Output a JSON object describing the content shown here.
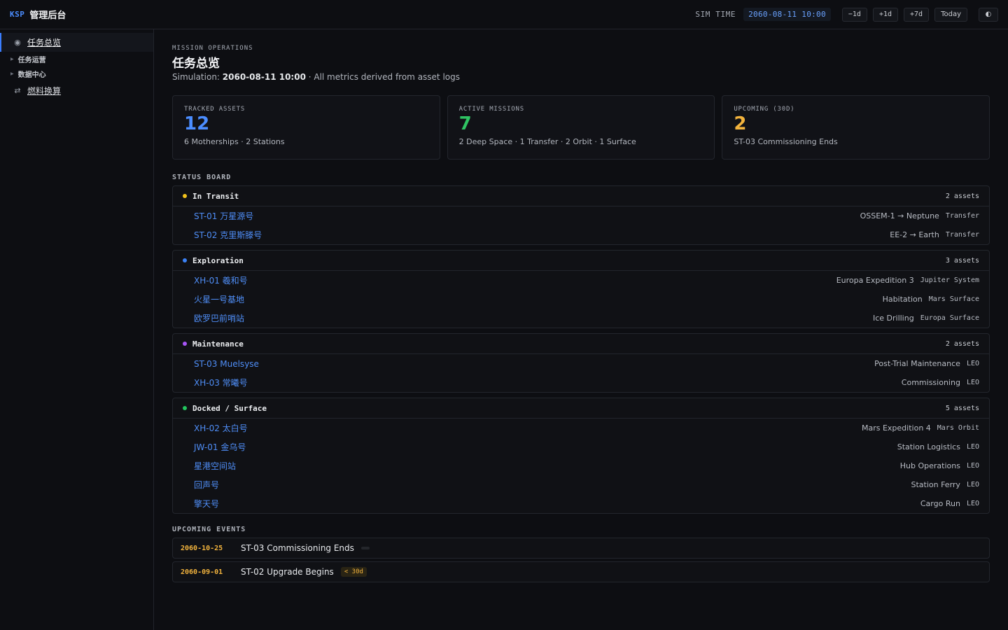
{
  "header": {
    "brand_tag": "KSP",
    "brand_name": "管理后台",
    "sim_time_label": "SIM TIME",
    "sim_time_value": "2060-08-11 10:00",
    "buttons": [
      "−1d",
      "+1d",
      "+7d",
      "Today"
    ],
    "theme_icon": "◐"
  },
  "sidebar": {
    "active_label": "任务总览",
    "group_ops": "任务运营",
    "group_data": "数据中心",
    "fuel_label": "燃料换算"
  },
  "page": {
    "eyebrow": "MISSION OPERATIONS",
    "title": "任务总览",
    "subtitle_prefix": "Simulation: ",
    "subtitle_time": "2060-08-11 10:00",
    "subtitle_suffix": " · All metrics derived from asset logs"
  },
  "stats": [
    {
      "label": "TRACKED ASSETS",
      "value": "12",
      "desc": "6 Motherships · 2 Stations",
      "color": "#4b8dff"
    },
    {
      "label": "ACTIVE MISSIONS",
      "value": "7",
      "desc": "2 Deep Space · 1 Transfer · 2 Orbit · 1 Surface",
      "color": "#2fc463"
    },
    {
      "label": "UPCOMING (30D)",
      "value": "2",
      "desc": "ST-03 Commissioning Ends",
      "color": "#f2b33d"
    }
  ],
  "status_board": {
    "label": "STATUS BOARD",
    "groups": [
      {
        "title": "In Transit",
        "count": "2 assets",
        "color": "#f2c21b",
        "rows": [
          {
            "name": "ST-01 万星源号",
            "desc": "OSSEM-1 → Neptune",
            "tag": "Transfer"
          },
          {
            "name": "ST-02 克里斯滕号",
            "desc": "EE-2 → Earth",
            "tag": "Transfer"
          }
        ]
      },
      {
        "title": "Exploration",
        "count": "3 assets",
        "color": "#3b82f6",
        "rows": [
          {
            "name": "XH-01 羲和号",
            "desc": "Europa Expedition 3",
            "tag": "Jupiter System"
          },
          {
            "name": "火星一号基地",
            "desc": "Habitation",
            "tag": "Mars Surface"
          },
          {
            "name": "欧罗巴前哨站",
            "desc": "Ice Drilling",
            "tag": "Europa Surface"
          }
        ]
      },
      {
        "title": "Maintenance",
        "count": "2 assets",
        "color": "#a855f7",
        "rows": [
          {
            "name": "ST-03 Muelsyse",
            "desc": "Post-Trial Maintenance",
            "tag": "LEO"
          },
          {
            "name": "XH-03 常曦号",
            "desc": "Commissioning",
            "tag": "LEO"
          }
        ]
      },
      {
        "title": "Docked / Surface",
        "count": "5 assets",
        "color": "#22c55e",
        "rows": [
          {
            "name": "XH-02 太白号",
            "desc": "Mars Expedition 4",
            "tag": "Mars Orbit"
          },
          {
            "name": "JW-01 金乌号",
            "desc": "Station Logistics",
            "tag": "LEO"
          },
          {
            "name": "星港空间站",
            "desc": "Hub Operations",
            "tag": "LEO"
          },
          {
            "name": "回声号",
            "desc": "Station Ferry",
            "tag": "LEO"
          },
          {
            "name": "擎天号",
            "desc": "Cargo Run",
            "tag": "LEO"
          }
        ]
      }
    ]
  },
  "events": {
    "label": "UPCOMING EVENTS",
    "items": [
      {
        "date": "2060-10-25",
        "name": "ST-03 Commissioning Ends",
        "badge": ""
      },
      {
        "date": "2060-09-01",
        "name": "ST-02 Upgrade Begins",
        "badge": "< 30d"
      }
    ]
  }
}
